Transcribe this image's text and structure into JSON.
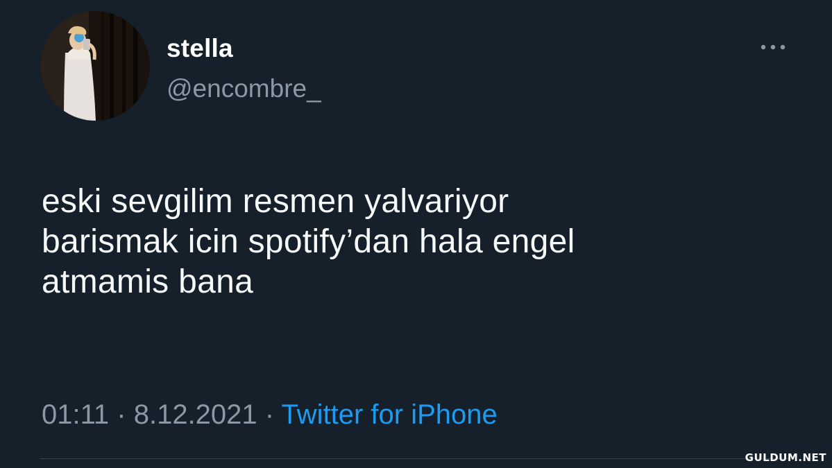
{
  "user": {
    "display_name": "stella",
    "handle": "@encombre_",
    "avatar_icon": "user-avatar-photo"
  },
  "menu": {
    "icon": "more-horizontal-icon"
  },
  "tweet": {
    "lines": [
      "eski sevgilim resmen yalvariyor",
      "barismak icin spotify’dan hala engel",
      "atmamis bana"
    ],
    "time": "01:11",
    "separator": "·",
    "date": "8.12.2021",
    "source": "Twitter for iPhone"
  },
  "watermark": "GULDUM.NET",
  "colors": {
    "background": "#15202b",
    "text": "#f7f9f9",
    "secondary": "#8b98a5",
    "link": "#1d9bf0",
    "divider": "#38444d"
  }
}
